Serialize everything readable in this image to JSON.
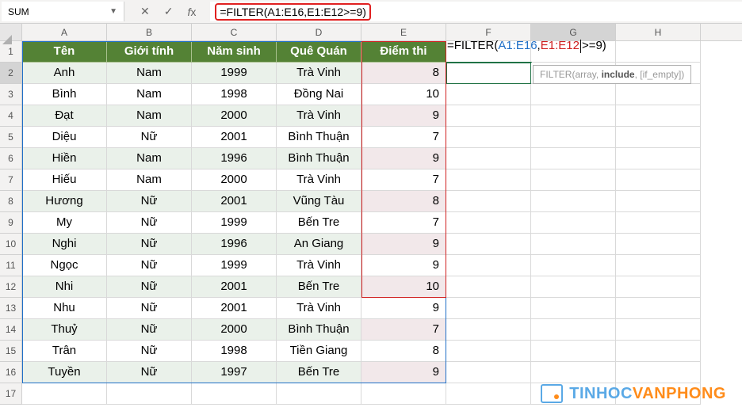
{
  "nameBox": "SUM",
  "formulaBar": "=FILTER(A1:E16,E1:E12>=9)",
  "columns": [
    "A",
    "B",
    "C",
    "D",
    "E",
    "F",
    "G",
    "H"
  ],
  "colWidths": {
    "A": 107,
    "B": 107,
    "C": 107,
    "D": 107,
    "E": 107,
    "F": 107,
    "G": 107,
    "H": 107
  },
  "headers": {
    "A": "Tên",
    "B": "Giới tính",
    "C": "Năm sinh",
    "D": "Quê Quán",
    "E": "Điểm thi"
  },
  "rows": [
    {
      "A": "Anh",
      "B": "Nam",
      "C": "1999",
      "D": "Trà Vinh",
      "E": "8"
    },
    {
      "A": "Bình",
      "B": "Nam",
      "C": "1998",
      "D": "Đồng Nai",
      "E": "10"
    },
    {
      "A": "Đạt",
      "B": "Nam",
      "C": "2000",
      "D": "Trà Vinh",
      "E": "9"
    },
    {
      "A": "Diệu",
      "B": "Nữ",
      "C": "2001",
      "D": "Bình Thuận",
      "E": "7"
    },
    {
      "A": "Hiền",
      "B": "Nam",
      "C": "1996",
      "D": "Bình Thuận",
      "E": "9"
    },
    {
      "A": "Hiếu",
      "B": "Nam",
      "C": "2000",
      "D": "Trà Vinh",
      "E": "7"
    },
    {
      "A": "Hương",
      "B": "Nữ",
      "C": "2001",
      "D": "Vũng Tàu",
      "E": "8"
    },
    {
      "A": "My",
      "B": "Nữ",
      "C": "1999",
      "D": "Bến Tre",
      "E": "7"
    },
    {
      "A": "Nghi",
      "B": "Nữ",
      "C": "1996",
      "D": "An Giang",
      "E": "9"
    },
    {
      "A": "Ngọc",
      "B": "Nữ",
      "C": "1999",
      "D": "Trà Vinh",
      "E": "9"
    },
    {
      "A": "Nhi",
      "B": "Nữ",
      "C": "2001",
      "D": "Bến Tre",
      "E": "10"
    },
    {
      "A": "Nhu",
      "B": "Nữ",
      "C": "2001",
      "D": "Trà Vinh",
      "E": "9"
    },
    {
      "A": "Thuỷ",
      "B": "Nữ",
      "C": "2000",
      "D": "Bình Thuận",
      "E": "7"
    },
    {
      "A": "Trân",
      "B": "Nữ",
      "C": "1998",
      "D": "Tiền Giang",
      "E": "8"
    },
    {
      "A": "Tuyền",
      "B": "Nữ",
      "C": "1997",
      "D": "Bến Tre",
      "E": "9"
    }
  ],
  "rowCount": 17,
  "editFormula": {
    "eq": "=",
    "fn": "FILTER(",
    "r1": "A1:E16",
    "comma": ",",
    "r2": "E1:E12",
    "tail": ">=9)"
  },
  "tooltip": {
    "fn": "FILTER(",
    "arg1": "array, ",
    "arg2": "include",
    "arg3": ", [if_empty])"
  },
  "watermark": {
    "t1": "TINHOC",
    "t2": "VANPHONG"
  },
  "activeCell": "F2"
}
